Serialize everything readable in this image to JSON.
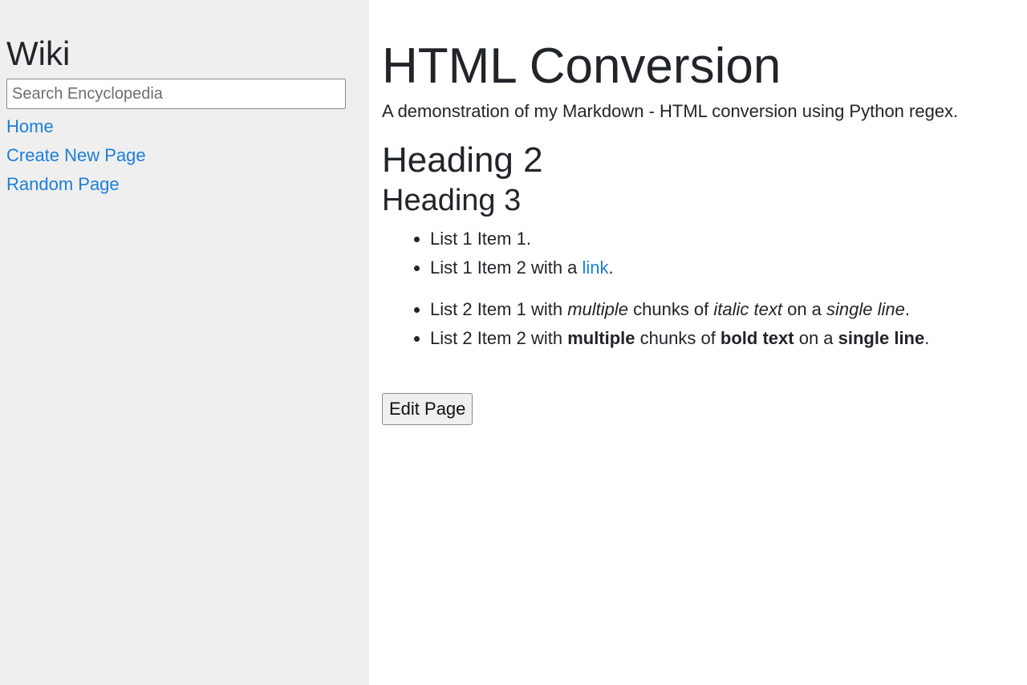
{
  "sidebar": {
    "title": "Wiki",
    "search_placeholder": "Search Encyclopedia",
    "nav": [
      "Home",
      "Create New Page",
      "Random Page"
    ]
  },
  "main": {
    "title": "HTML Conversion",
    "intro": "A demonstration of my Markdown - HTML conversion using Python regex.",
    "heading2": "Heading 2",
    "heading3": "Heading 3",
    "list1": {
      "item1": "List 1 Item 1.",
      "item2_prefix": "List 1 Item 2 with a ",
      "item2_link": "link",
      "item2_suffix": "."
    },
    "list2": {
      "item1": {
        "t1": "List 2 Item 1 with ",
        "i1": "multiple",
        "t2": " chunks of ",
        "i2": "italic text",
        "t3": " on a ",
        "i3": "single line",
        "t4": "."
      },
      "item2": {
        "t1": "List 2 Item 2 with ",
        "b1": "multiple",
        "t2": " chunks of ",
        "b2": "bold text",
        "t3": " on a ",
        "b3": "single line",
        "t4": "."
      }
    },
    "edit_button": "Edit Page"
  },
  "colors": {
    "sidebar_bg": "#efefef",
    "link": "#1a7fd9",
    "text": "#212529"
  }
}
